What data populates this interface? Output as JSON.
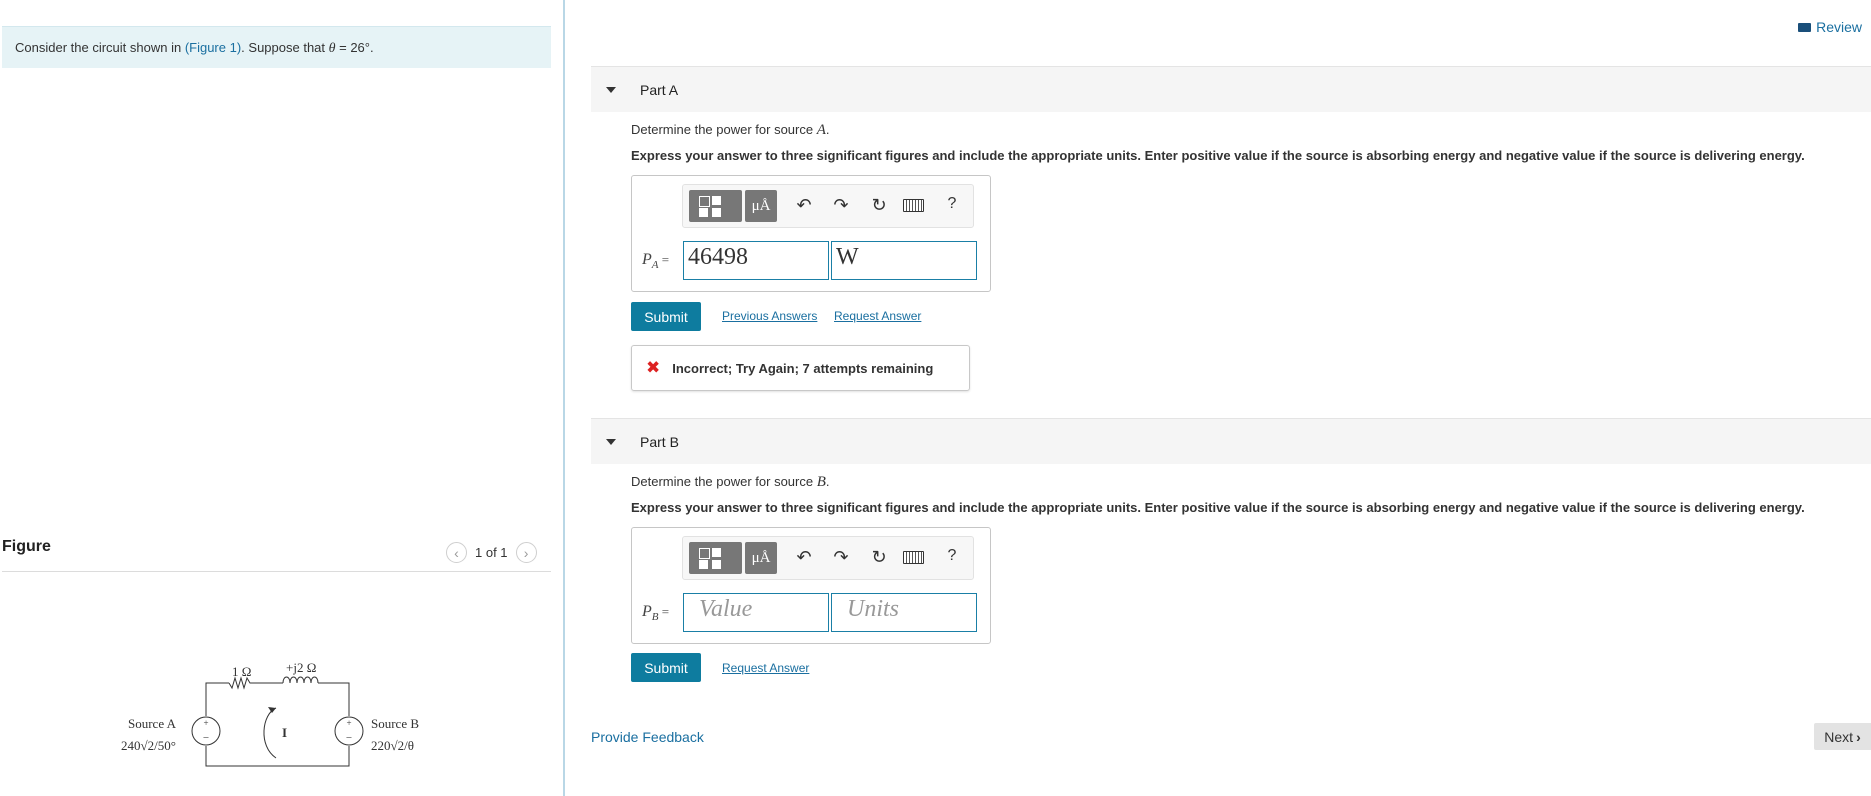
{
  "problem": {
    "text_before": "Consider the circuit shown in ",
    "figure_link": "(Figure 1)",
    "text_after": ". Suppose that ",
    "theta_symbol": "θ",
    "theta_value": " = 26°."
  },
  "figure": {
    "title": "Figure",
    "pager": "1 of 1",
    "prev_icon": "chevron-left-icon",
    "next_icon": "chevron-right-icon",
    "circuit": {
      "r1": "1 Ω",
      "l1": "+j2 Ω",
      "current": "I",
      "source_a_name": "Source A",
      "source_a_value": "240√2/50°",
      "source_b_name": "Source B",
      "source_b_value": "220√2/θ"
    }
  },
  "header": {
    "review_label": "Review",
    "review_icon": "book-icon"
  },
  "parts": [
    {
      "title": "Part A",
      "question_prefix": "Determine the power for source ",
      "question_var": "A",
      "question_suffix": ".",
      "instruction": "Express your answer to three significant figures and include the appropriate units. Enter positive value if the source is absorbing energy and negative value if the source is delivering energy.",
      "var_label": "P",
      "var_sub": "A",
      "eq": " =",
      "value": "46498",
      "units": "W",
      "submit": "Submit",
      "links": [
        "Previous Answers",
        "Request Answer"
      ],
      "feedback": "Incorrect; Try Again; 7 attempts remaining"
    },
    {
      "title": "Part B",
      "question_prefix": "Determine the power for source ",
      "question_var": "B",
      "question_suffix": ".",
      "instruction": "Express your answer to three significant figures and include the appropriate units. Enter positive value if the source is absorbing energy and negative value if the source is delivering energy.",
      "var_label": "P",
      "var_sub": "B",
      "eq": " =",
      "value_placeholder": "Value",
      "units_placeholder": "Units",
      "submit": "Submit",
      "links": [
        "Request Answer"
      ]
    }
  ],
  "toolbar": {
    "mu_label": "μÅ",
    "help_label": "?"
  },
  "footer": {
    "provide_feedback": "Provide Feedback",
    "next": "Next"
  },
  "colors": {
    "accent": "#0e7c9f",
    "link": "#1a6fa0",
    "error": "#dd2222",
    "problem_bg": "#e6f3f6"
  }
}
